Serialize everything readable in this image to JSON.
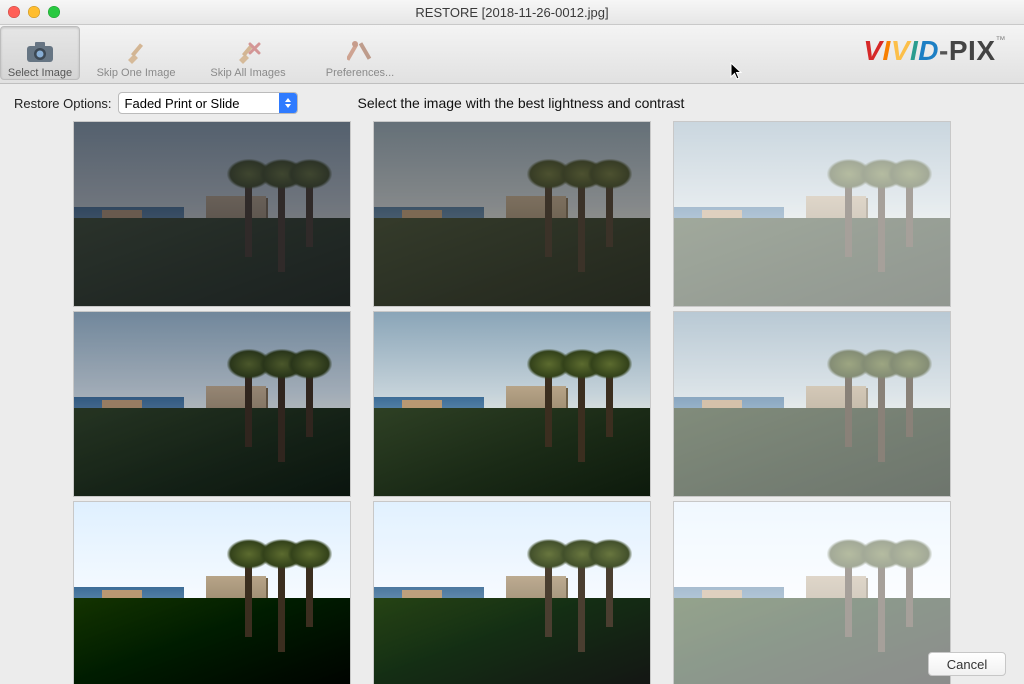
{
  "window": {
    "title": "RESTORE [2018-11-26-0012.jpg]"
  },
  "toolbar": {
    "select_image": "Select Image",
    "skip_one": "Skip One Image",
    "skip_all": "Skip All Images",
    "preferences": "Preferences..."
  },
  "logo": {
    "text": "VIVID-PIX",
    "tm": "™"
  },
  "options": {
    "label": "Restore Options:",
    "selected": "Faded Print or Slide",
    "choices": [
      "Faded Print or Slide"
    ]
  },
  "instruction": "Select the image with the best lightness and contrast",
  "thumbnails": {
    "count": 9,
    "variants": [
      "dark-faded",
      "dark-warm",
      "light-washed",
      "normal-cool",
      "normal",
      "normal-light",
      "vivid",
      "vivid-bright",
      "vivid-washed"
    ]
  },
  "buttons": {
    "cancel": "Cancel"
  },
  "colors": {
    "accent_blue": "#2f7bff",
    "toolbar_bg": "#e8e8e8",
    "window_bg": "#ececec"
  }
}
